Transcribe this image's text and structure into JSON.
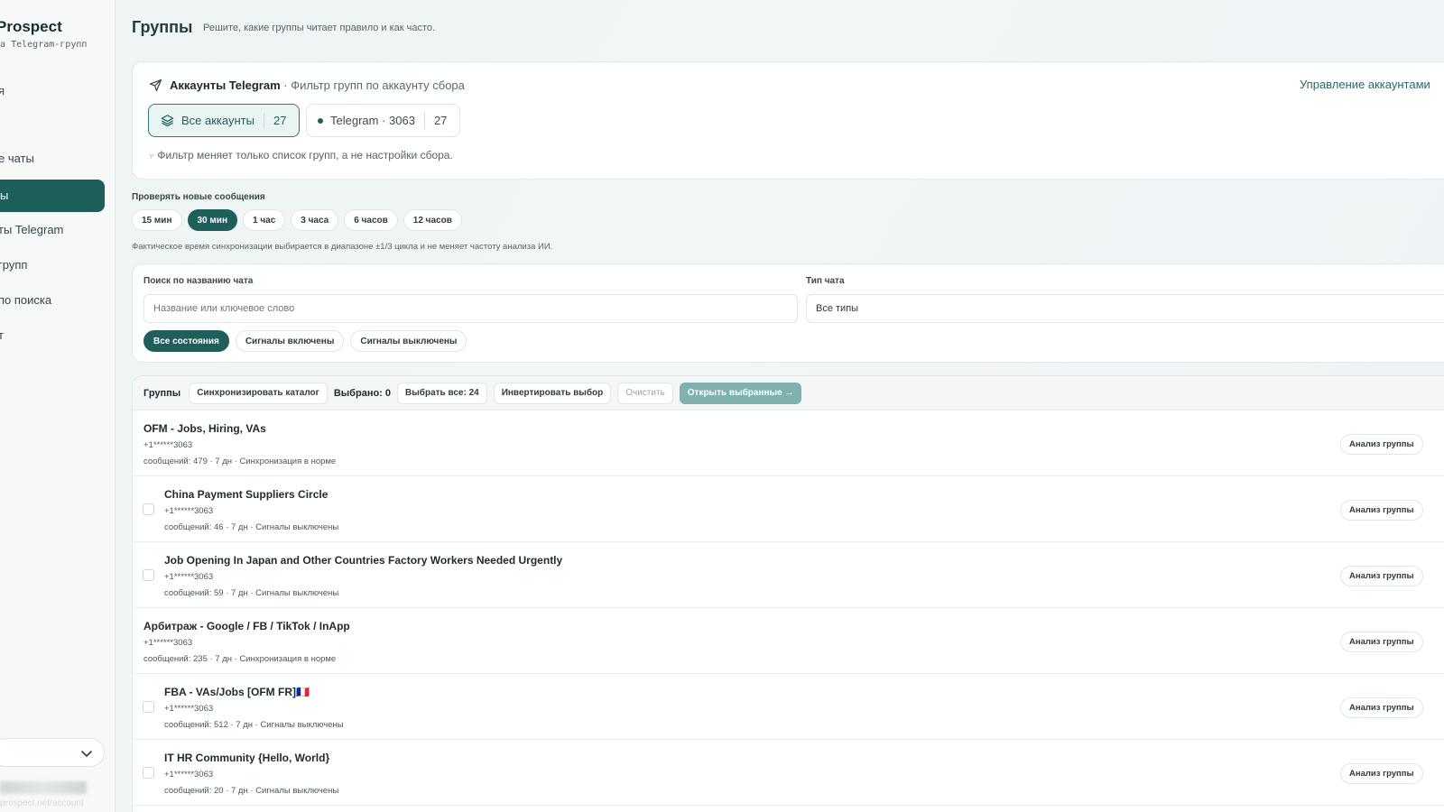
{
  "sidebar": {
    "brand_name": "Prospect",
    "brand_sub": "тика Telegram-групп",
    "items": [
      {
        "label": "я"
      },
      {
        "label": "е чаты"
      },
      {
        "label": "ы"
      },
      {
        "label": "ты Telegram"
      },
      {
        "label": "групп"
      },
      {
        "label": "по поиска"
      },
      {
        "label": "т"
      }
    ],
    "active_index": 2,
    "footer_text": "prospect.net/account"
  },
  "header": {
    "title": "Группы",
    "subtitle": "Решите, какие группы читает правило и как часто."
  },
  "accounts": {
    "title": "Аккаунты Telegram",
    "subtitle": "· Фильтр групп по аккаунту сбора",
    "manage_label": "Управление аккаунтами",
    "all_label": "Все аккаунты",
    "all_count": "27",
    "tg_label": "Telegram · 3063",
    "tg_count": "27",
    "note": "Фильтр меняет только список групп, а не настройки сбора."
  },
  "intervals": {
    "label": "Проверять новые сообщения",
    "options": [
      "15 мин",
      "30 мин",
      "1 час",
      "3 часа",
      "6 часов",
      "12 часов"
    ],
    "active_index": 1,
    "note": "Фактическое время синхронизации выбирается в диапазоне ±1/3 цикла и не меняет частоту анализа ИИ."
  },
  "filters": {
    "search_label": "Поиск по названию чата",
    "search_placeholder": "Название или ключевое слово",
    "type_label": "Тип чата",
    "type_value": "Все типы",
    "states": [
      "Все состояния",
      "Сигналы включены",
      "Сигналы выключены"
    ],
    "active_state": 0
  },
  "groups_bar": {
    "title": "Группы",
    "sync_label": "Синхронизировать каталог",
    "selected_label": "Выбрано: 0",
    "select_all_label": "Выбрать все: 24",
    "invert_label": "Инвертировать выбор",
    "clear_label": "Очистить",
    "open_label": "Открыть выбранные →"
  },
  "analyze_label": "Анализ группы",
  "groups": [
    {
      "title": "OFM - Jobs, Hiring, VAs",
      "phone": "+1******3063",
      "meta": "сообщений: 479 · 7 дн · Синхронизация в норме",
      "checkbox": false
    },
    {
      "title": "China Payment Suppliers Circle",
      "phone": "+1******3063",
      "meta": "сообщений: 46 · 7 дн · Сигналы выключены",
      "checkbox": true
    },
    {
      "title": "Job Opening In Japan and Other Countries Factory Workers Needed Urgently",
      "phone": "+1******3063",
      "meta": "сообщений: 59 · 7 дн · Сигналы выключены",
      "checkbox": true
    },
    {
      "title": "Арбитраж - Google / FB / TikTok / InApp",
      "phone": "+1******3063",
      "meta": "сообщений: 235 · 7 дн · Синхронизация в норме",
      "checkbox": false
    },
    {
      "title": "FBA - VAs/Jobs [OFM FR]🇫🇷",
      "phone": "+1******3063",
      "meta": "сообщений: 512 · 7 дн · Сигналы выключены",
      "checkbox": true
    },
    {
      "title": "IT HR Community {Hello, World}",
      "phone": "+1******3063",
      "meta": "сообщений: 20 · 7 дн · Сигналы выключены",
      "checkbox": true
    }
  ],
  "colors": {
    "accent": "#1e5f5c",
    "accent_light": "#7fb2ae"
  }
}
